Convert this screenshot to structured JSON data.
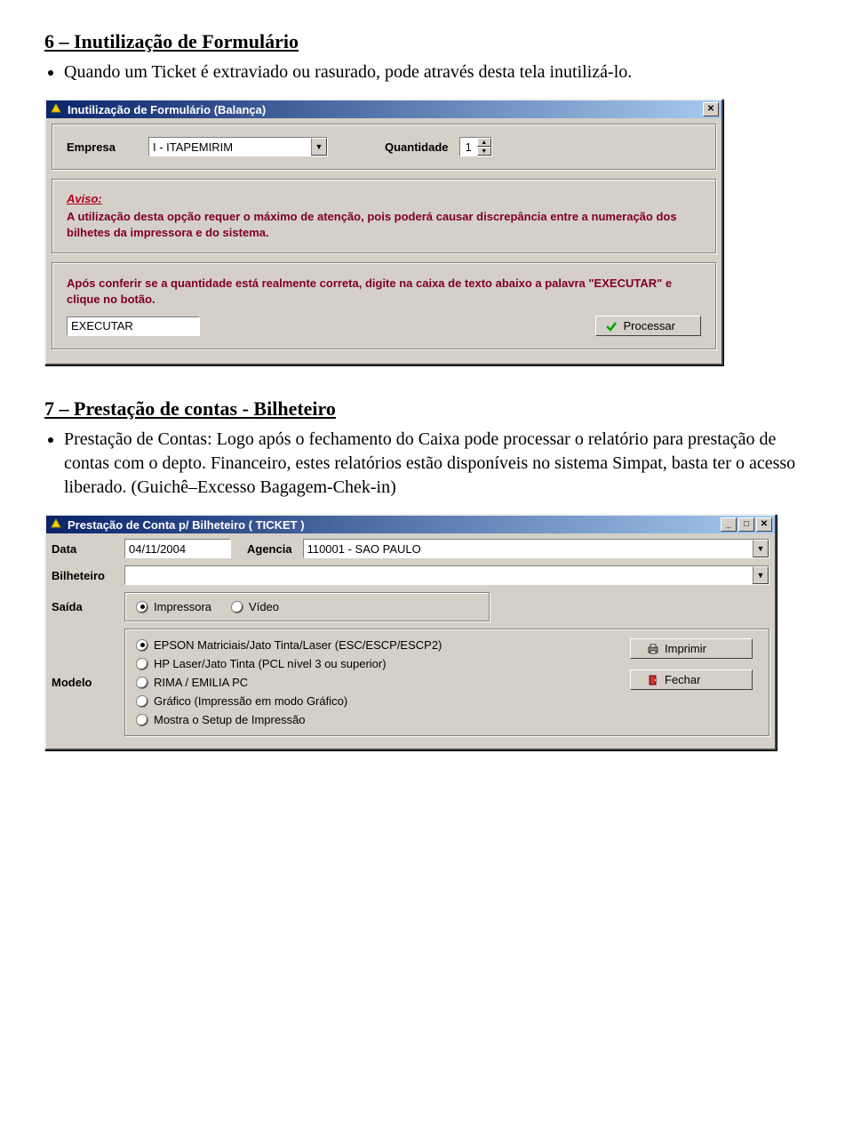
{
  "section6": {
    "heading": "6 – Inutilização de Formulário",
    "bullet": "Quando um Ticket é extraviado ou rasurado, pode através desta tela inutilizá-lo."
  },
  "dialog1": {
    "title": "Inutilização de Formulário   (Balança)",
    "empresa_label": "Empresa",
    "empresa_value": "I  - ITAPEMIRIM",
    "quantidade_label": "Quantidade",
    "quantidade_value": "1",
    "aviso_label": "Aviso:",
    "aviso_text": "A utilização desta opção requer o máximo de atenção, pois poderá causar discrepância entre a numeração dos bilhetes da impressora e do sistema.",
    "instr_text": "Após conferir se a quantidade está realmente correta, digite na caixa de texto abaixo a palavra \"EXECUTAR\" e clique no botão.",
    "executar_value": "EXECUTAR",
    "processar_label": "Processar"
  },
  "section7": {
    "heading": "7 – Prestação de contas - Bilheteiro",
    "bullet": "Prestação de Contas: Logo após o fechamento do Caixa pode processar o relatório para prestação de contas com o depto. Financeiro, estes relatórios estão disponíveis no sistema Simpat, basta ter o acesso liberado. (Guichê–Excesso Bagagem-Chek-in)"
  },
  "dialog2": {
    "title": "Prestação de Conta p/ Bilheteiro ( TICKET )",
    "data_label": "Data",
    "data_value": "04/11/2004",
    "agencia_label": "Agencia",
    "agencia_value": "110001 - SAO PAULO",
    "bilheteiro_label": "Bilheteiro",
    "bilheteiro_value": "",
    "saida_label": "Saída",
    "saida_opts": {
      "impressora": "Impressora",
      "video": "Vídeo"
    },
    "saida_selected": "impressora",
    "modelo_label": "Modelo",
    "modelo_opts": [
      "EPSON Matriciais/Jato Tinta/Laser (ESC/ESCP/ESCP2)",
      "HP Laser/Jato Tinta (PCL nível 3 ou superior)",
      "RIMA / EMILIA PC",
      "Gráfico (Impressão em modo Gráfico)",
      "Mostra o Setup de Impressão"
    ],
    "modelo_selected_index": 0,
    "imprimir_label": "Imprimir",
    "fechar_label": "Fechar"
  }
}
